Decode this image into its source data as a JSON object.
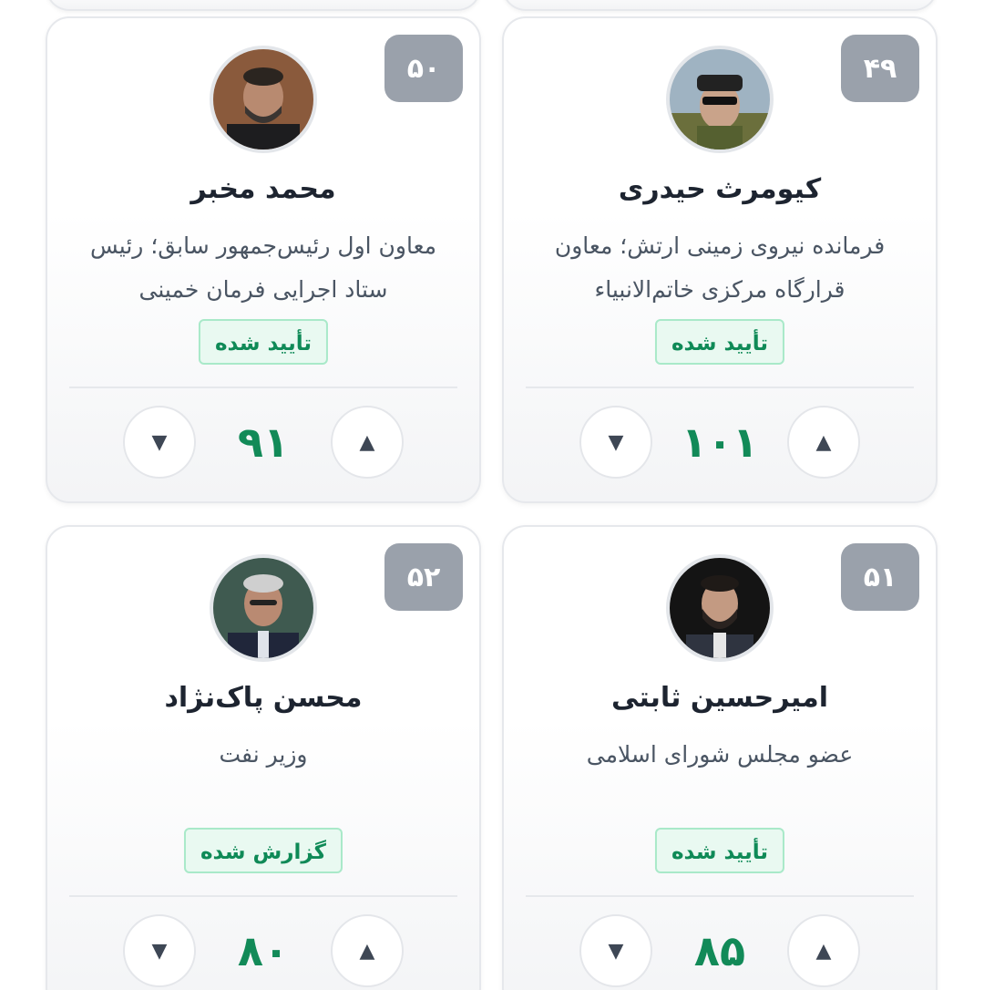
{
  "cards": [
    {
      "rank": "۴۹",
      "name": "کیومرث حیدری",
      "role": "فرمانده نیروی زمینی ارتش؛ معاون قرارگاه مرکزی خاتم‌الانبیاء",
      "status": "تأیید شده",
      "score": "۱۰۱",
      "upvote_icon": "▲",
      "downvote_icon": "▼"
    },
    {
      "rank": "۵۰",
      "name": "محمد مخبر",
      "role": "معاون اول رئیس‌جمهور سابق؛ رئیس ستاد اجرایی فرمان خمینی",
      "status": "تأیید شده",
      "score": "۹۱",
      "upvote_icon": "▲",
      "downvote_icon": "▼"
    },
    {
      "rank": "۵۱",
      "name": "امیرحسین ثابتی",
      "role": "عضو مجلس شورای اسلامی",
      "status": "تأیید شده",
      "score": "۸۵",
      "upvote_icon": "▲",
      "downvote_icon": "▼"
    },
    {
      "rank": "۵۲",
      "name": "محسن پاک‌نژاد",
      "role": "وزیر نفت",
      "status": "گزارش شده",
      "score": "۸۰",
      "upvote_icon": "▲",
      "downvote_icon": "▼"
    }
  ],
  "colors": {
    "rank_badge": "#9aa1ab",
    "score": "#128a58",
    "status_text": "#0f8a57",
    "status_bg": "#e9f9f1",
    "status_border": "#a9e9c9"
  }
}
